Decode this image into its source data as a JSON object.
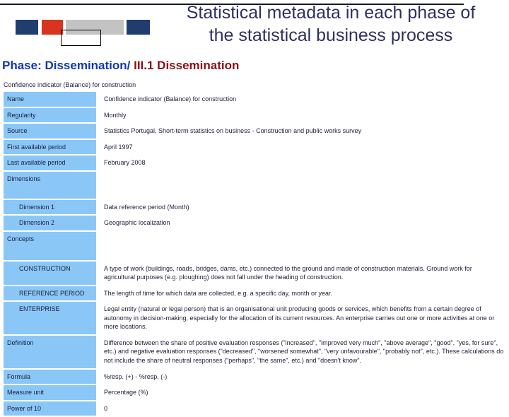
{
  "header": {
    "title_line1": "Statistical metadata in each phase of",
    "title_line2": "the statistical business process",
    "title_color": "#2f2f63",
    "rule_color": "#17172e",
    "logo": {
      "name": "statistics-portugal-logo",
      "colors": [
        "#1f3d6e",
        "#d8341f",
        "#c3c3c3",
        "#1f3d6e"
      ]
    }
  },
  "phase": {
    "phase_label": "Phase: Dissemination/",
    "sub_label": " III.1 Dissemination",
    "phase_color": "#1038b0",
    "sub_color": "#8a1118"
  },
  "table": {
    "caption": "Confidence indicator (Balance) for construction",
    "label_bg": "#8ac7f7",
    "rows": [
      {
        "label": "Name",
        "value": "Confidence indicator (Balance) for construction",
        "indent": false
      },
      {
        "label": "Regularity",
        "value": "Monthly",
        "indent": false
      },
      {
        "label": "Source",
        "value": "Statistics Portugal,  Short-term statistics on business -  Construction and public works survey",
        "indent": false
      },
      {
        "label": "First available period",
        "value": "April 1997",
        "indent": false
      },
      {
        "label": "Last available period",
        "value": "February 2008",
        "indent": false
      },
      {
        "label": "Dimensions",
        "value": "",
        "indent": false
      },
      {
        "label": "Dimension 1",
        "value": "Data reference period (Month)",
        "indent": true
      },
      {
        "label": "Dimension 2",
        "value": "Geographic localization",
        "indent": true
      },
      {
        "label": "Concepts",
        "value": "",
        "indent": false
      },
      {
        "label": "CONSTRUCTION",
        "value": "A type of work (buildings, roads, bridges, dams, etc.) connected to the ground and made of construction materials. Ground work for agricultural purposes (e.g. ploughing) does not fall under the heading of construction.",
        "indent": true
      },
      {
        "label": "REFERENCE PERIOD",
        "value": "The length of time for which data are collected, e.g. a specific day, month or year.",
        "indent": true
      },
      {
        "label": "ENTERPRISE",
        "value": "Legal entity (natural or legal person) that is an organisational unit producing goods or services, which benefits from a certain degree of autonomy in decision-making, especially for the allocation of its current resources. An enterprise carries out one or more activities at one or more locations.",
        "indent": true
      },
      {
        "label": "Definition",
        "value": "Difference between the share of positive evaluation responses (\"increased\", \"improved very much\", \"above average\", \"good\", \"yes, for sure\", etc.) and negative evaluation responses (\"decreased\", \"worsened somewhat\", \"very unfavourable\", \"probably not\", etc.). These calculations do not include the share of neutral responses (\"perhaps\", \"the same\", etc.) and \"doesn't know\".",
        "indent": false
      },
      {
        "label": "Formula",
        "value": "%resp. (+) - %resp. (-)",
        "indent": false
      },
      {
        "label": "Measure unit",
        "value": "Percentage (%)",
        "indent": false
      },
      {
        "label": "Power of 10",
        "value": "0",
        "indent": false
      }
    ]
  }
}
